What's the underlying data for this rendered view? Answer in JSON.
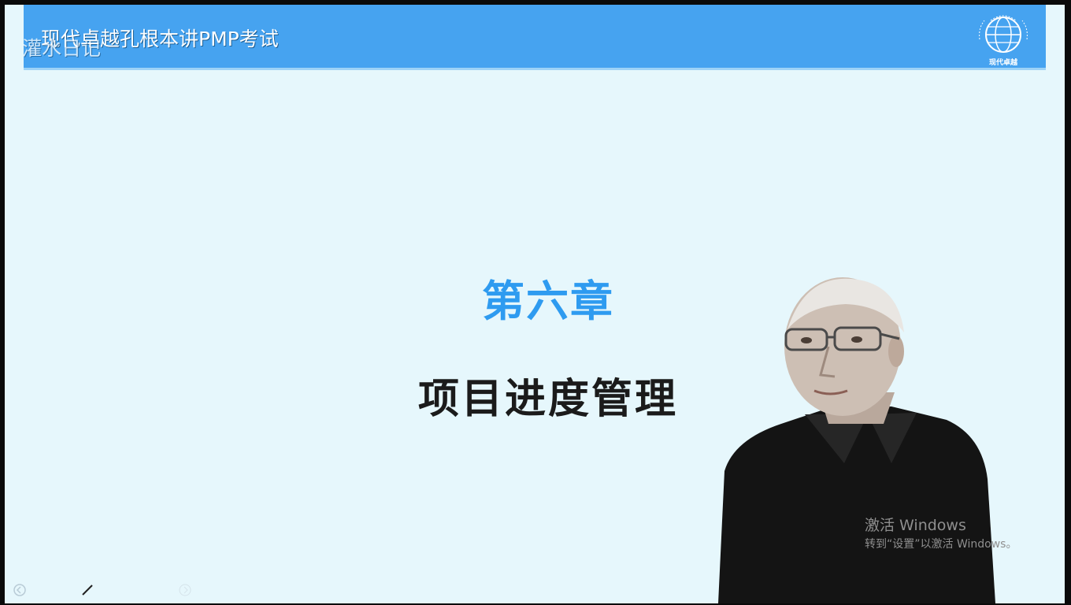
{
  "header": {
    "title": "现代卓越孔根本讲PMP考试",
    "overlay_text": "灌水日记",
    "logo_caption": "现代卓越"
  },
  "slide": {
    "chapter": "第六章",
    "topic": "项目进度管理"
  },
  "watermark": {
    "title": "激活 Windows",
    "subtitle": "转到“设置”以激活 Windows。"
  },
  "toolbar": {
    "icons": [
      "previous-icon",
      "pen-icon",
      "next-icon"
    ]
  },
  "colors": {
    "header_bg": "#46a3f0",
    "slide_bg": "#e6f7fc",
    "chapter": "#2e9bf0",
    "topic": "#1b1b1b"
  }
}
